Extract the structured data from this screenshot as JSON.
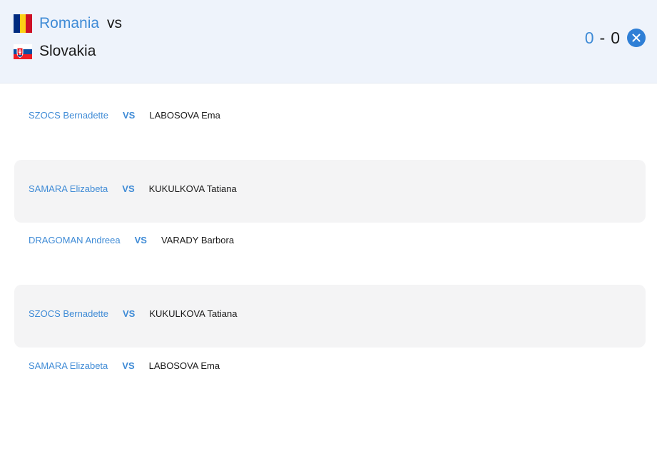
{
  "header": {
    "home_team": "Romania",
    "away_team": "Slovakia",
    "vs_label": "vs",
    "home_score": "0",
    "score_separator": "-",
    "away_score": "0",
    "home_flag_icon": "romania-flag-icon",
    "away_flag_icon": "slovakia-flag-icon",
    "close_icon": "close-icon"
  },
  "colors": {
    "accent": "#3f8bd6",
    "header_bg": "#eef3fb",
    "row_shade": "#f4f4f5",
    "close_button": "#2f7fd6"
  },
  "matches": [
    {
      "player1": "SZOCS Bernadette",
      "vs": "VS",
      "player2": "LABOSOVA Ema",
      "shaded": false
    },
    {
      "player1": "SAMARA Elizabeta",
      "vs": "VS",
      "player2": "KUKULKOVA Tatiana",
      "shaded": true
    },
    {
      "player1": "DRAGOMAN Andreea",
      "vs": "VS",
      "player2": "VARADY Barbora",
      "shaded": false
    },
    {
      "player1": "SZOCS Bernadette",
      "vs": "VS",
      "player2": "KUKULKOVA Tatiana",
      "shaded": true
    },
    {
      "player1": "SAMARA Elizabeta",
      "vs": "VS",
      "player2": "LABOSOVA Ema",
      "shaded": false
    }
  ]
}
